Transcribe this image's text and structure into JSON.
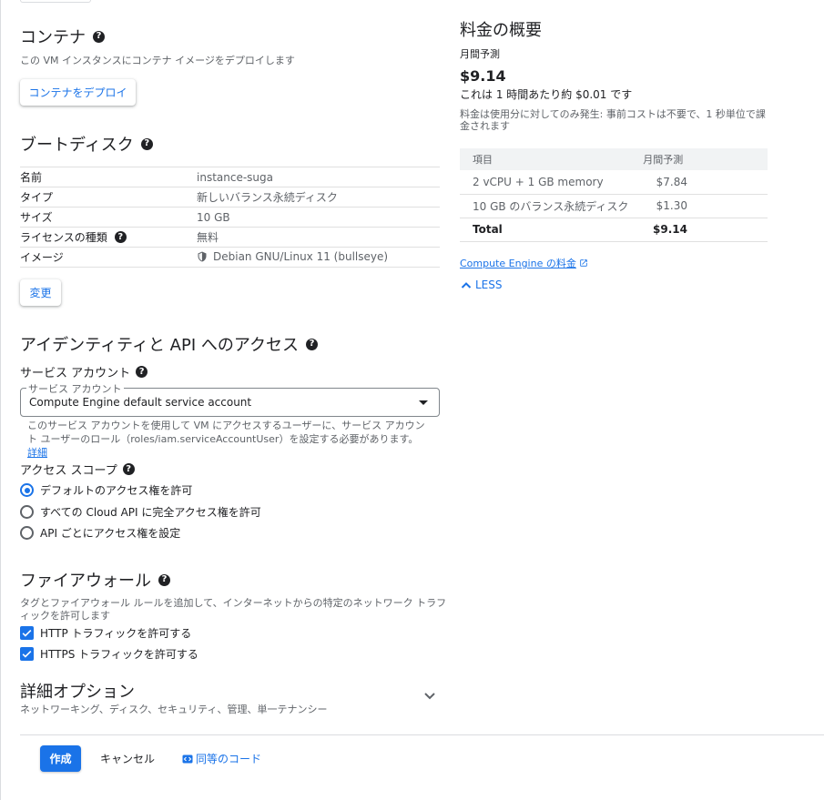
{
  "container": {
    "title": "コンテナ",
    "description": "この VM インスタンスにコンテナ イメージをデプロイします",
    "deploy_button": "コンテナをデプロイ"
  },
  "boot_disk": {
    "title": "ブートディスク",
    "rows": [
      {
        "label": "名前",
        "value": "instance-suga"
      },
      {
        "label": "タイプ",
        "value": "新しいバランス永続ディスク"
      },
      {
        "label": "サイズ",
        "value": "10 GB"
      },
      {
        "label": "ライセンスの種類",
        "value": "無料"
      },
      {
        "label": "イメージ",
        "value": "Debian GNU/Linux 11 (bullseye)"
      }
    ],
    "change_button": "変更"
  },
  "identity": {
    "title": "アイデンティティと API へのアクセス",
    "service_account_heading": "サービス アカウント",
    "select_legend": "サービス アカウント",
    "select_value": "Compute Engine default service account",
    "hint": "このサービス アカウントを使用して VM にアクセスするユーザーに、サービス アカウント ユーザーのロール（roles/iam.serviceAccountUser）を設定する必要があります。",
    "hint_link": "詳細",
    "access_scope_heading": "アクセス スコープ",
    "scopes": [
      {
        "label": "デフォルトのアクセス権を許可",
        "selected": true
      },
      {
        "label": "すべての Cloud API に完全アクセス権を許可",
        "selected": false
      },
      {
        "label": "API ごとにアクセス権を設定",
        "selected": false
      }
    ]
  },
  "firewall": {
    "title": "ファイアウォール",
    "description_line1": "タグとファイアウォール ルールを追加して、インターネットからの特定のネットワーク トラフ",
    "description_line2": "ィックを許可します",
    "options": [
      {
        "label": "HTTP トラフィックを許可する",
        "checked": true
      },
      {
        "label": "HTTPS トラフィックを許可する",
        "checked": true
      }
    ]
  },
  "advanced": {
    "title": "詳細オプション",
    "subtitle": "ネットワーキング、ディスク、セキュリティ、管理、単一テナンシー"
  },
  "footer": {
    "create": "作成",
    "cancel": "キャンセル",
    "code": "同等のコード"
  },
  "pricing": {
    "title": "料金の概要",
    "monthly_label": "月間予測",
    "price": "$9.14",
    "hourly": "これは 1 時間あたり約 $0.01 です",
    "note": "料金は使用分に対してのみ発生: 事前コストは不要で、1 秒単位で課金されます",
    "table_headers": [
      "項目",
      "月間予測"
    ],
    "rows": [
      {
        "item": "2 vCPU + 1 GB memory",
        "cost": "$7.84"
      },
      {
        "item": "10 GB のバランス永続ディスク",
        "cost": "$1.30"
      }
    ],
    "total_label": "Total",
    "total_value": "$9.14",
    "link": "Compute Engine の料金",
    "less": "LESS"
  },
  "colors": {
    "accent": "#1a73e8",
    "text": "#202124",
    "muted": "#5f6368"
  }
}
